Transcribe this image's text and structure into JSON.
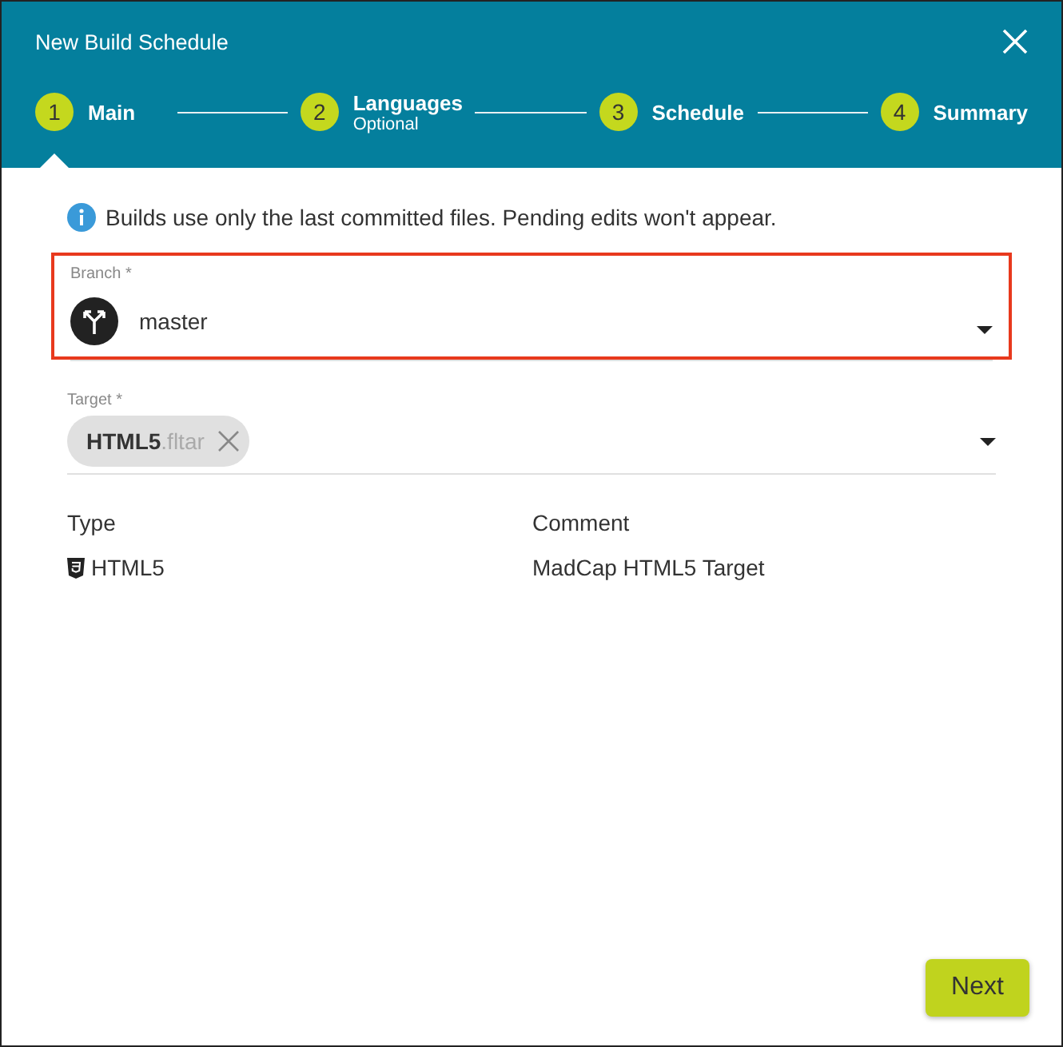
{
  "window": {
    "title": "New Build Schedule"
  },
  "steps": [
    {
      "number": "1",
      "label": "Main",
      "selected": true
    },
    {
      "number": "2",
      "label": "Languages",
      "sublabel": "Optional",
      "selected": false
    },
    {
      "number": "3",
      "label": "Schedule",
      "selected": false
    },
    {
      "number": "4",
      "label": "Summary",
      "selected": false
    }
  ],
  "info": "Builds use only the last committed files. Pending edits won't appear.",
  "branch": {
    "label": "Branch *",
    "value": "master",
    "highlighted": true
  },
  "target": {
    "label": "Target *",
    "chip_name": "HTML5",
    "chip_ext": ".fltar"
  },
  "table": {
    "columns": [
      "Type",
      "Comment"
    ],
    "rows": [
      {
        "type": "HTML5",
        "comment": "MadCap HTML5 Target"
      }
    ]
  },
  "buttons": [
    "Next"
  ]
}
